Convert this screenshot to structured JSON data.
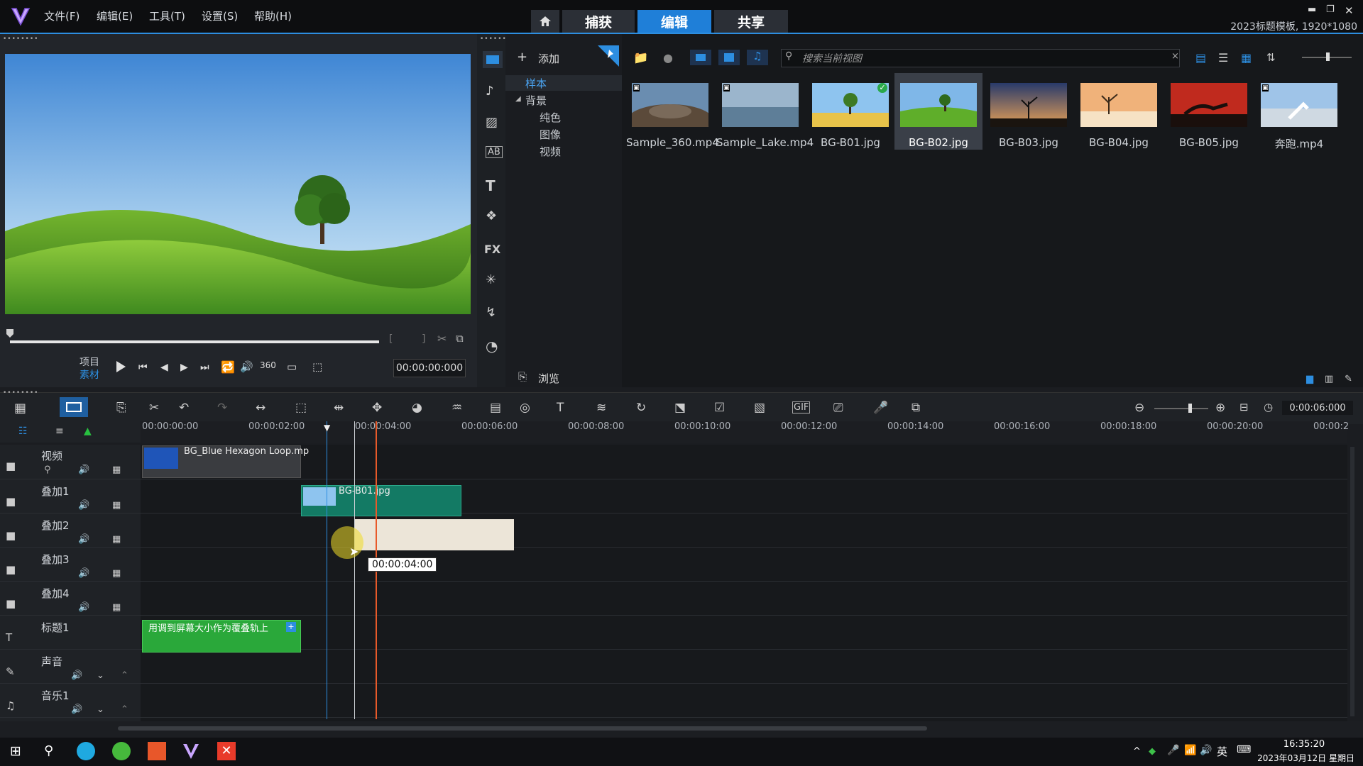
{
  "app": {
    "menu": [
      "文件(F)",
      "编辑(E)",
      "工具(T)",
      "设置(S)",
      "帮助(H)"
    ],
    "mode_tabs": [
      "捕获",
      "编辑",
      "共享"
    ],
    "active_mode": "编辑",
    "project_info": "2023标题模板, 1920*1080",
    "accent": "#1f7fd8"
  },
  "player": {
    "project_label": "项目",
    "clip_label": "素材",
    "timecode": "00:00:00:000"
  },
  "library": {
    "add_label": "添加",
    "search_placeholder": "搜索当前视图",
    "browse_label": "浏览",
    "tree": {
      "root": "样本",
      "group": "背景",
      "children": [
        "纯色",
        "图像",
        "视频"
      ]
    },
    "thumbnails": [
      {
        "label": "Sample_360.mp4",
        "icon": "video-badge-icon"
      },
      {
        "label": "Sample_Lake.mp4",
        "icon": "video-badge-icon"
      },
      {
        "label": "BG-B01.jpg",
        "icon": "check-badge-icon"
      },
      {
        "label": "BG-B02.jpg",
        "icon": "",
        "selected": true
      },
      {
        "label": "BG-B03.jpg",
        "icon": ""
      },
      {
        "label": "BG-B04.jpg",
        "icon": ""
      },
      {
        "label": "BG-B05.jpg",
        "icon": ""
      },
      {
        "label": "奔跑.mp4",
        "icon": "video-badge-icon"
      }
    ]
  },
  "toolbar": {
    "zoom_timecode": "0:00:06:000"
  },
  "timeline": {
    "ruler_ticks": [
      "00:00:00:00",
      "00:00:02:00",
      "00:00:04:00",
      "00:00:06:00",
      "00:00:08:00",
      "00:00:10:00",
      "00:00:12:00",
      "00:00:14:00",
      "00:00:16:00",
      "00:00:18:00",
      "00:00:20:00",
      "00:00:2"
    ],
    "tracks": [
      "视频",
      "叠加1",
      "叠加2",
      "叠加3",
      "叠加4",
      "标题1",
      "声音",
      "音乐1"
    ],
    "clips": {
      "video_clip": "BG_Blue Hexagon Loop.mp",
      "overlay1_clip": "BG-B01.jpg",
      "title_clip": "用调到屏幕大小作为覆叠轨上"
    },
    "drag_tooltip": "00:00:04:00"
  },
  "taskbar": {
    "lang": "英",
    "time": "16:35:20",
    "date": "2023年03月12日 星期日"
  }
}
